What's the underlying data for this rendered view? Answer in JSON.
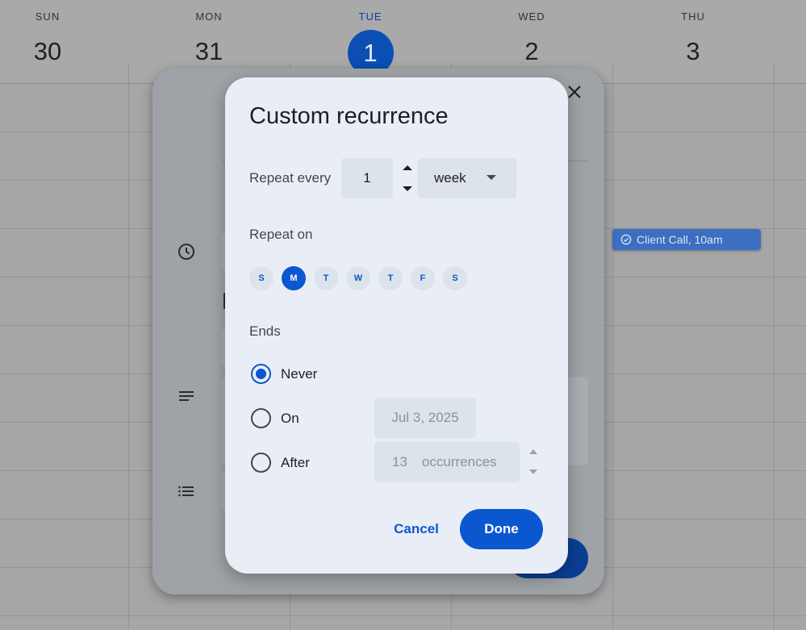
{
  "calendar": {
    "days": [
      {
        "name": "SUN",
        "number": "30"
      },
      {
        "name": "MON",
        "number": "31"
      },
      {
        "name": "TUE",
        "number": "1",
        "today": true
      },
      {
        "name": "WED",
        "number": "2"
      },
      {
        "name": "THU",
        "number": "3"
      }
    ],
    "event": {
      "label": "Client Call, 10am",
      "icon": "check-circle-icon",
      "color": "#3c6ec1"
    }
  },
  "recurrence": {
    "title": "Custom recurrence",
    "repeat_every_label": "Repeat every",
    "interval": "1",
    "unit": "week",
    "repeat_on_label": "Repeat on",
    "weekdays": [
      {
        "label": "S",
        "selected": false
      },
      {
        "label": "M",
        "selected": true
      },
      {
        "label": "T",
        "selected": false
      },
      {
        "label": "W",
        "selected": false
      },
      {
        "label": "T",
        "selected": false
      },
      {
        "label": "F",
        "selected": false
      },
      {
        "label": "S",
        "selected": false
      }
    ],
    "ends_label": "Ends",
    "ends_options": {
      "never": {
        "label": "Never",
        "checked": true
      },
      "on": {
        "label": "On",
        "checked": false,
        "value": "Jul 3, 2025"
      },
      "after": {
        "label": "After",
        "checked": false,
        "count": "13",
        "suffix": "occurrences"
      }
    },
    "cancel_label": "Cancel",
    "done_label": "Done",
    "accent_color": "#0b57d0"
  }
}
